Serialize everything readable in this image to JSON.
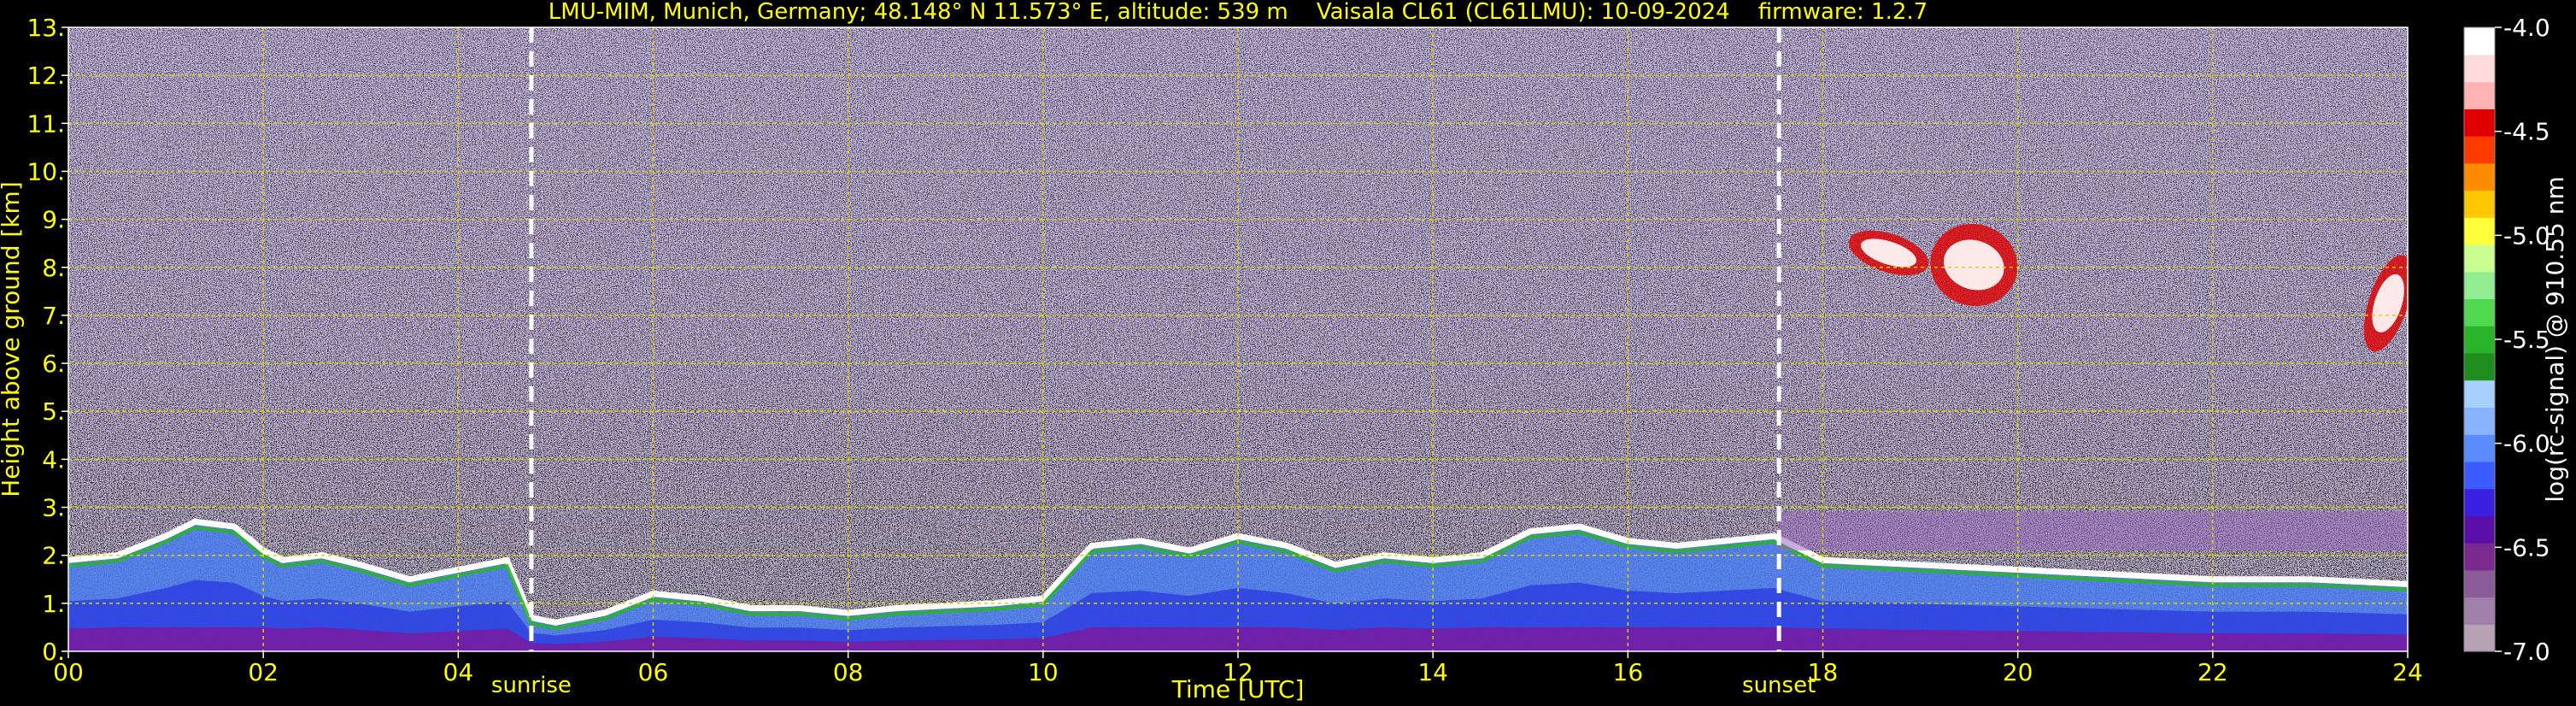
{
  "chart_data": {
    "type": "heatmap",
    "title": "LMU-MIM, Munich, Germany; 48.148° N 11.573° E, altitude: 539 m    Vaisala CL61 (CL61LMU): 10-09-2024    firmware: 1.2.7",
    "xlabel": "Time [UTC]",
    "ylabel": "Height above ground [km]",
    "xlim": [
      0,
      24
    ],
    "ylim": [
      0,
      13
    ],
    "x_ticks": [
      0,
      2,
      4,
      6,
      8,
      10,
      12,
      14,
      16,
      18,
      20,
      22,
      24
    ],
    "x_tick_labels": [
      "00",
      "02",
      "04",
      "06",
      "08",
      "10",
      "12",
      "14",
      "16",
      "18",
      "20",
      "22",
      "24"
    ],
    "y_ticks": [
      0,
      1,
      2,
      3,
      4,
      5,
      6,
      7,
      8,
      9,
      10,
      11,
      12,
      13
    ],
    "y_tick_labels": [
      "0.",
      "1.",
      "2.",
      "3.",
      "4.",
      "5.",
      "6.",
      "7.",
      "8.",
      "9.",
      "10.",
      "11.",
      "12.",
      "13."
    ],
    "grid": true,
    "colorbar": {
      "label": "log(rc-signal) @ 910.55 nm",
      "range": [
        -7.0,
        -4.0
      ],
      "ticks": [
        -7.0,
        -6.5,
        -6.0,
        -5.5,
        -5.0,
        -4.5,
        -4.0
      ],
      "tick_labels": [
        "-7.0",
        "-6.5",
        "-6.0",
        "-5.5",
        "-5.0",
        "-4.5",
        "-4.0"
      ],
      "colors": [
        "#b8a2b6",
        "#a080a8",
        "#8a5c98",
        "#7a2a8c",
        "#5a10a8",
        "#3a20e0",
        "#3c5cff",
        "#5a8cff",
        "#88b4ff",
        "#a8d0ff",
        "#1e8c1e",
        "#2ab42a",
        "#50d850",
        "#90ee90",
        "#c8ff90",
        "#ffff3c",
        "#ffc800",
        "#ff8c00",
        "#ff3c00",
        "#e00000",
        "#ffb4b4",
        "#ffdcdc",
        "#ffffff"
      ]
    },
    "annotations": [
      {
        "label": "sunrise",
        "x": 4.75
      },
      {
        "label": "sunset",
        "x": 17.55
      }
    ],
    "features": {
      "boundary_layer_top": [
        [
          0.0,
          1.9
        ],
        [
          0.5,
          2.0
        ],
        [
          1.0,
          2.4
        ],
        [
          1.3,
          2.7
        ],
        [
          1.7,
          2.6
        ],
        [
          2.0,
          2.1
        ],
        [
          2.2,
          1.9
        ],
        [
          2.6,
          2.0
        ],
        [
          3.0,
          1.8
        ],
        [
          3.5,
          1.5
        ],
        [
          4.0,
          1.7
        ],
        [
          4.5,
          1.9
        ],
        [
          4.75,
          0.7
        ],
        [
          5.0,
          0.6
        ],
        [
          5.5,
          0.8
        ],
        [
          6.0,
          1.2
        ],
        [
          6.5,
          1.1
        ],
        [
          7.0,
          0.9
        ],
        [
          7.5,
          0.9
        ],
        [
          8.0,
          0.8
        ],
        [
          8.5,
          0.9
        ],
        [
          9.0,
          0.95
        ],
        [
          9.5,
          1.0
        ],
        [
          10.0,
          1.1
        ],
        [
          10.5,
          2.2
        ],
        [
          11.0,
          2.3
        ],
        [
          11.5,
          2.1
        ],
        [
          12.0,
          2.4
        ],
        [
          12.5,
          2.2
        ],
        [
          13.0,
          1.8
        ],
        [
          13.5,
          2.0
        ],
        [
          14.0,
          1.9
        ],
        [
          14.5,
          2.0
        ],
        [
          15.0,
          2.5
        ],
        [
          15.5,
          2.6
        ],
        [
          16.0,
          2.3
        ],
        [
          16.5,
          2.2
        ],
        [
          17.0,
          2.3
        ],
        [
          17.5,
          2.4
        ],
        [
          18.0,
          1.9
        ],
        [
          19.0,
          1.8
        ],
        [
          20.0,
          1.7
        ],
        [
          21.0,
          1.6
        ],
        [
          22.0,
          1.5
        ],
        [
          23.0,
          1.5
        ],
        [
          24.0,
          1.4
        ]
      ],
      "high_clouds": [
        {
          "x0": 18.25,
          "x1": 19.1,
          "base": 7.9,
          "top": 8.7
        },
        {
          "x0": 19.1,
          "x1": 20.0,
          "base": 7.2,
          "top": 8.9
        },
        {
          "x0": 23.6,
          "x1": 24.0,
          "base": 6.2,
          "top": 8.3
        }
      ],
      "night_aerosol_layer": {
        "x0": 17.55,
        "x1": 24.0,
        "base": 2.1,
        "top": 2.9
      }
    }
  }
}
